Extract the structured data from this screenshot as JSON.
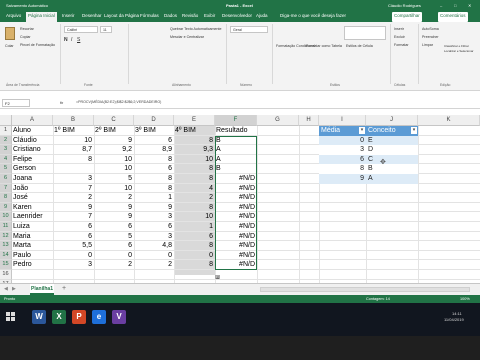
{
  "window": {
    "autosave_label": "Salvamento Automático",
    "doc_title": "Pasta1 - Excel",
    "user_name": "Cláudio Rodrigues",
    "window_controls": [
      "–",
      "□",
      "✕"
    ]
  },
  "ribbon_tabs": [
    "Arquivo",
    "Página Inicial",
    "Inserir",
    "Desenhar",
    "Layout da Página",
    "Fórmulas",
    "Dados",
    "Revisão",
    "Exibir",
    "Desenvolvedor",
    "Ajuda"
  ],
  "tell_me": "Diga-me o que você deseja fazer",
  "share_label": "Compartilhar",
  "comments_label": "Comentários",
  "ribbon": {
    "paste_label": "Colar",
    "clipboard_items": [
      "Recortar",
      "Copiar",
      "Pincel de Formatação"
    ],
    "font_name": "Calibri",
    "font_size": "11",
    "wrap_text": "Quebrar Texto Automaticamente",
    "merge_center": "Mesclar e Centralizar",
    "number_format": "Geral",
    "conditional_format": "Formatação Condicional",
    "format_as_table": "Formatar como Tabela",
    "cell_styles": "Estilos de Célula",
    "insert": "Inserir",
    "delete": "Excluir",
    "format": "Formatar",
    "autosum": "AutoSoma",
    "fill": "Preencher",
    "clear": "Limpar",
    "sort_filter": "Classificar e Filtrar",
    "find_select": "Localizar e Selecionar",
    "groups": [
      "Área de Transferência",
      "Fonte",
      "Alinhamento",
      "Número",
      "Estilos",
      "Células",
      "Edição"
    ]
  },
  "formula_bar": {
    "name_box": "F2",
    "fx": "fx",
    "formula": "=PROCV(MÉDIA(B2:E2);$I$2:$J$6;2;VERDADEIRO)"
  },
  "columns": [
    "A",
    "B",
    "C",
    "D",
    "E",
    "F",
    "G",
    "H",
    "I",
    "J",
    "K"
  ],
  "rows": [
    {
      "n": "1",
      "a": "Aluno",
      "b": "1º BIM",
      "c": "2º BIM",
      "d": "3º BIM",
      "e": "4º BIM",
      "f": "Resultado"
    },
    {
      "n": "2",
      "a": "Cláudio",
      "b": "10",
      "c": "9",
      "d": "6",
      "e": "8",
      "f": "B"
    },
    {
      "n": "3",
      "a": "Cristiano",
      "b": "8,7",
      "c": "9,2",
      "d": "8,9",
      "e": "9,3",
      "f": "A"
    },
    {
      "n": "4",
      "a": "Felipe",
      "b": "8",
      "c": "10",
      "d": "8",
      "e": "10",
      "f": "A"
    },
    {
      "n": "5",
      "a": "Gerson",
      "c": "10",
      "d": "6",
      "e": "8",
      "f": "B"
    },
    {
      "n": "6",
      "a": "Joana",
      "b": "3",
      "c": "5",
      "d": "8",
      "e": "8",
      "f": "#N/D"
    },
    {
      "n": "7",
      "a": "João",
      "b": "7",
      "c": "10",
      "d": "8",
      "e": "4",
      "f": "#N/D"
    },
    {
      "n": "8",
      "a": "José",
      "b": "2",
      "c": "2",
      "d": "1",
      "e": "2",
      "f": "#N/D"
    },
    {
      "n": "9",
      "a": "Karen",
      "b": "9",
      "c": "9",
      "d": "9",
      "e": "8",
      "f": "#N/D"
    },
    {
      "n": "10",
      "a": "Laenrider",
      "b": "7",
      "c": "9",
      "d": "3",
      "e": "10",
      "f": "#N/D"
    },
    {
      "n": "11",
      "a": "Luiza",
      "b": "6",
      "c": "6",
      "d": "6",
      "e": "1",
      "f": "#N/D"
    },
    {
      "n": "12",
      "a": "Maria",
      "b": "6",
      "c": "5",
      "d": "3",
      "e": "6",
      "f": "#N/D"
    },
    {
      "n": "13",
      "a": "Marta",
      "b": "5,5",
      "c": "6",
      "d": "4,8",
      "e": "8",
      "f": "#N/D"
    },
    {
      "n": "14",
      "a": "Paulo",
      "b": "0",
      "c": "0",
      "d": "0",
      "e": "0",
      "f": "#N/D"
    },
    {
      "n": "15",
      "a": "Pedro",
      "b": "3",
      "c": "2",
      "d": "2",
      "e": "8",
      "f": "#N/D"
    },
    {
      "n": "16"
    },
    {
      "n": "17"
    }
  ],
  "lookup_table": {
    "header": [
      "Média",
      "Conceito"
    ],
    "rows": [
      [
        "0",
        "E"
      ],
      [
        "3",
        "D"
      ],
      [
        "6",
        "C"
      ],
      [
        "8",
        "B"
      ],
      [
        "9",
        "A"
      ]
    ]
  },
  "sheet_tab": "Planilha1",
  "add_sheet": "+",
  "status": {
    "left": "Pronto",
    "count": "Contagem: 14",
    "zoom": "100%"
  },
  "taskbar": {
    "icons": [
      "W",
      "X",
      "P",
      "e",
      "V"
    ],
    "clock_time": "14:11",
    "clock_date": "11/04/2019"
  },
  "colors": {
    "excel_green": "#217346",
    "table_header": "#5b9bd5",
    "table_band": "#ddebf7"
  }
}
